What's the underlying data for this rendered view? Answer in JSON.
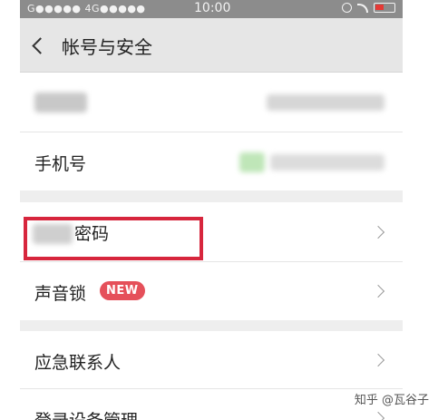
{
  "status_bar": {
    "left": "G●●●●● 4G●●●●●",
    "time": "10:00"
  },
  "nav": {
    "title": "帐号与安全"
  },
  "rows": {
    "account": {
      "label": "",
      "value": ""
    },
    "phone": {
      "label": "手机号"
    },
    "password": {
      "label": "密码"
    },
    "voice_lock": {
      "label": "声音锁",
      "badge": "NEW"
    },
    "emergency": {
      "label": "应急联系人"
    },
    "devices": {
      "label": "登录设备管理"
    }
  },
  "watermark": "知乎 @瓦谷子",
  "colors": {
    "nav_bg": "#e6e6e6",
    "badge": "#e5505a",
    "highlight": "#d7263d",
    "status_bar": "#8c8c8c",
    "section_gap": "#eeeeee"
  }
}
